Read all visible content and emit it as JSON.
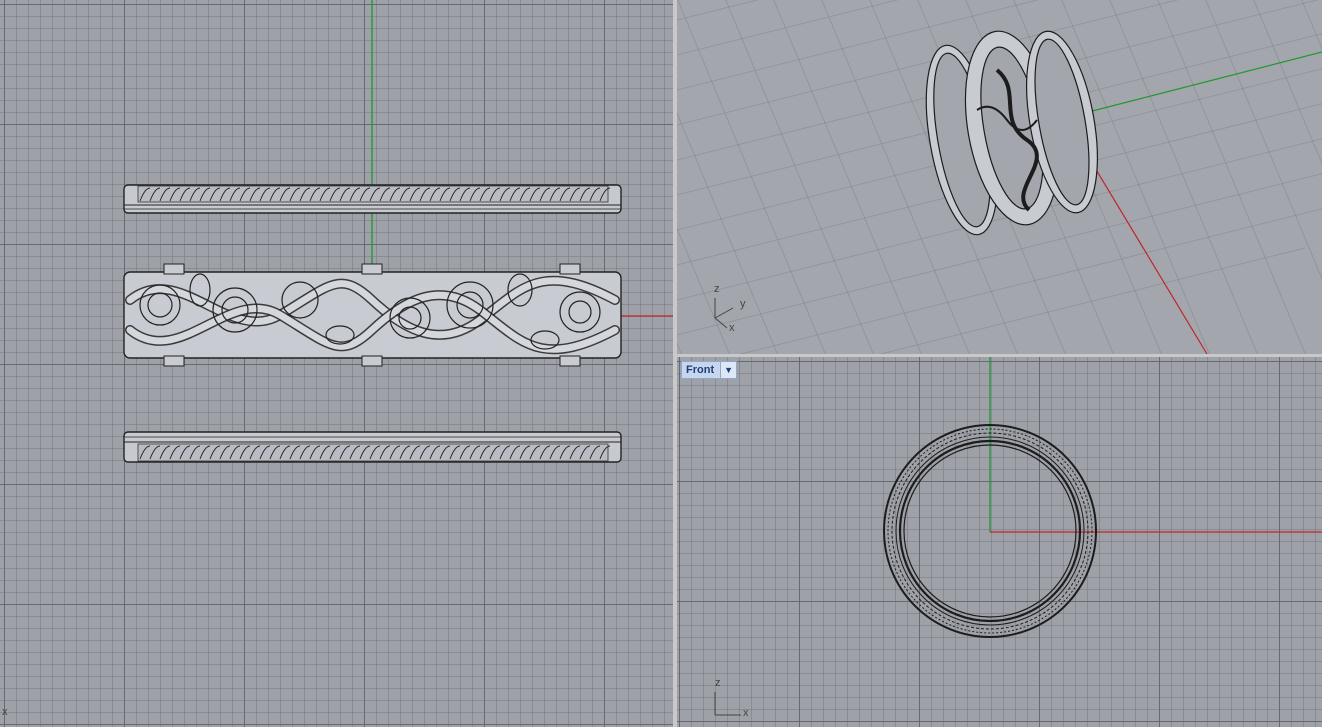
{
  "viewports": {
    "left": {
      "axis_icon": "x",
      "grid_visible": true
    },
    "perspective": {
      "axis_icon": {
        "z": "z",
        "y": "y",
        "x": "x"
      },
      "grid_visible": true
    },
    "front": {
      "title": "Front",
      "menu_icon": "dropdown-arrow-icon",
      "axis_icon": {
        "z": "z",
        "x": "x"
      },
      "grid_visible": true
    }
  },
  "colors": {
    "viewport_bg": "#9ea1a8",
    "x_axis": "#c0262a",
    "y_axis": "#1c9a2e",
    "model_fill": "#c9ccd2",
    "wire": "#1c1c1c",
    "title_bg": "#c5d6ee",
    "title_text": "#1e3e78"
  },
  "model": {
    "name_icon": "ring-set-model",
    "parts": [
      "top-band",
      "filigree-band",
      "bottom-band"
    ]
  }
}
